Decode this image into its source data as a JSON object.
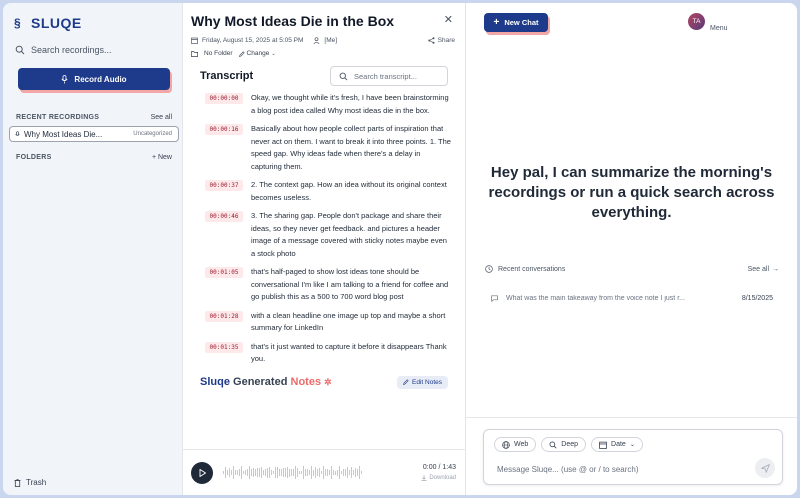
{
  "sidebar": {
    "logo": "SLUQE",
    "search_placeholder": "Search recordings...",
    "record_label": "Record Audio",
    "recent_title": "RECENT RECORDINGS",
    "see_all": "See all",
    "recent_item": {
      "label": "Why Most Ideas Die...",
      "tag": "Uncategorized"
    },
    "folders_title": "FOLDERS",
    "new_folder": "+ New",
    "trash": "Trash"
  },
  "transcript": {
    "title": "Why Most Ideas Die in the Box",
    "date": "Friday, August 15, 2025 at 5:05 PM",
    "author": "[Me]",
    "share": "Share",
    "folder": "No Folder",
    "change": "Change",
    "heading": "Transcript",
    "search_placeholder": "Search transcript...",
    "entries": [
      {
        "ts": "00:00:00",
        "text": "Okay, we thought while it's fresh, I have been brainstorming a blog post idea called Why most ideas die in the box."
      },
      {
        "ts": "00:00:16",
        "text": "Basically about how people collect parts of inspiration that never act on them. I want to break it into three points. 1. The speed gap. Why ideas fade when there's a delay in capturing them."
      },
      {
        "ts": "00:00:37",
        "text": "2. The context gap. How an idea without its original context becomes useless."
      },
      {
        "ts": "00:00:46",
        "text": "3. The sharing gap. People don't package and share their ideas, so they never get feedback. and pictures a header image of a message covered with sticky notes maybe even a stock photo"
      },
      {
        "ts": "00:01:05",
        "text": "that's half-paged to show lost ideas tone should be conversational I'm like I am talking to a friend for coffee and go publish this as a 500 to 700 word blog post"
      },
      {
        "ts": "00:01:28",
        "text": "with a clean headline one image up top and maybe a short summary for LinkedIn"
      },
      {
        "ts": "00:01:35",
        "text": "that's it just wanted to capture it before it disappears Thank you."
      }
    ],
    "notes_title_a": "Sluqe",
    "notes_title_b": "Generated",
    "notes_title_c": "Notes",
    "edit_notes": "Edit Notes",
    "time": "0:00 / 1:43",
    "download": "Download"
  },
  "chat": {
    "new_chat": "New Chat",
    "avatar": "TA",
    "menu": "Menu",
    "hero": "Hey pal, I can summarize the morning's recordings or run a quick search across everything.",
    "recent_title": "Recent conversations",
    "see_all": "See all",
    "conversation": {
      "text": "What was the main takeaway from the voice note I just r...",
      "date": "8/15/2025"
    },
    "chips": [
      "Web",
      "Deep",
      "Date"
    ],
    "placeholder": "Message Sluqe... (use @ or / to search)"
  },
  "colors": {
    "brand": "#1e3a8a",
    "accent": "#ec6b6b",
    "timestamp_bg": "#fde8ea"
  },
  "icons": [
    "search-icon",
    "mic-icon",
    "trash-icon",
    "calendar-icon",
    "user-icon",
    "share-icon",
    "folder-icon",
    "pencil-icon",
    "play-icon",
    "download-icon",
    "globe-icon",
    "clock-icon",
    "chat-icon",
    "send-icon",
    "sparkle-icon"
  ]
}
